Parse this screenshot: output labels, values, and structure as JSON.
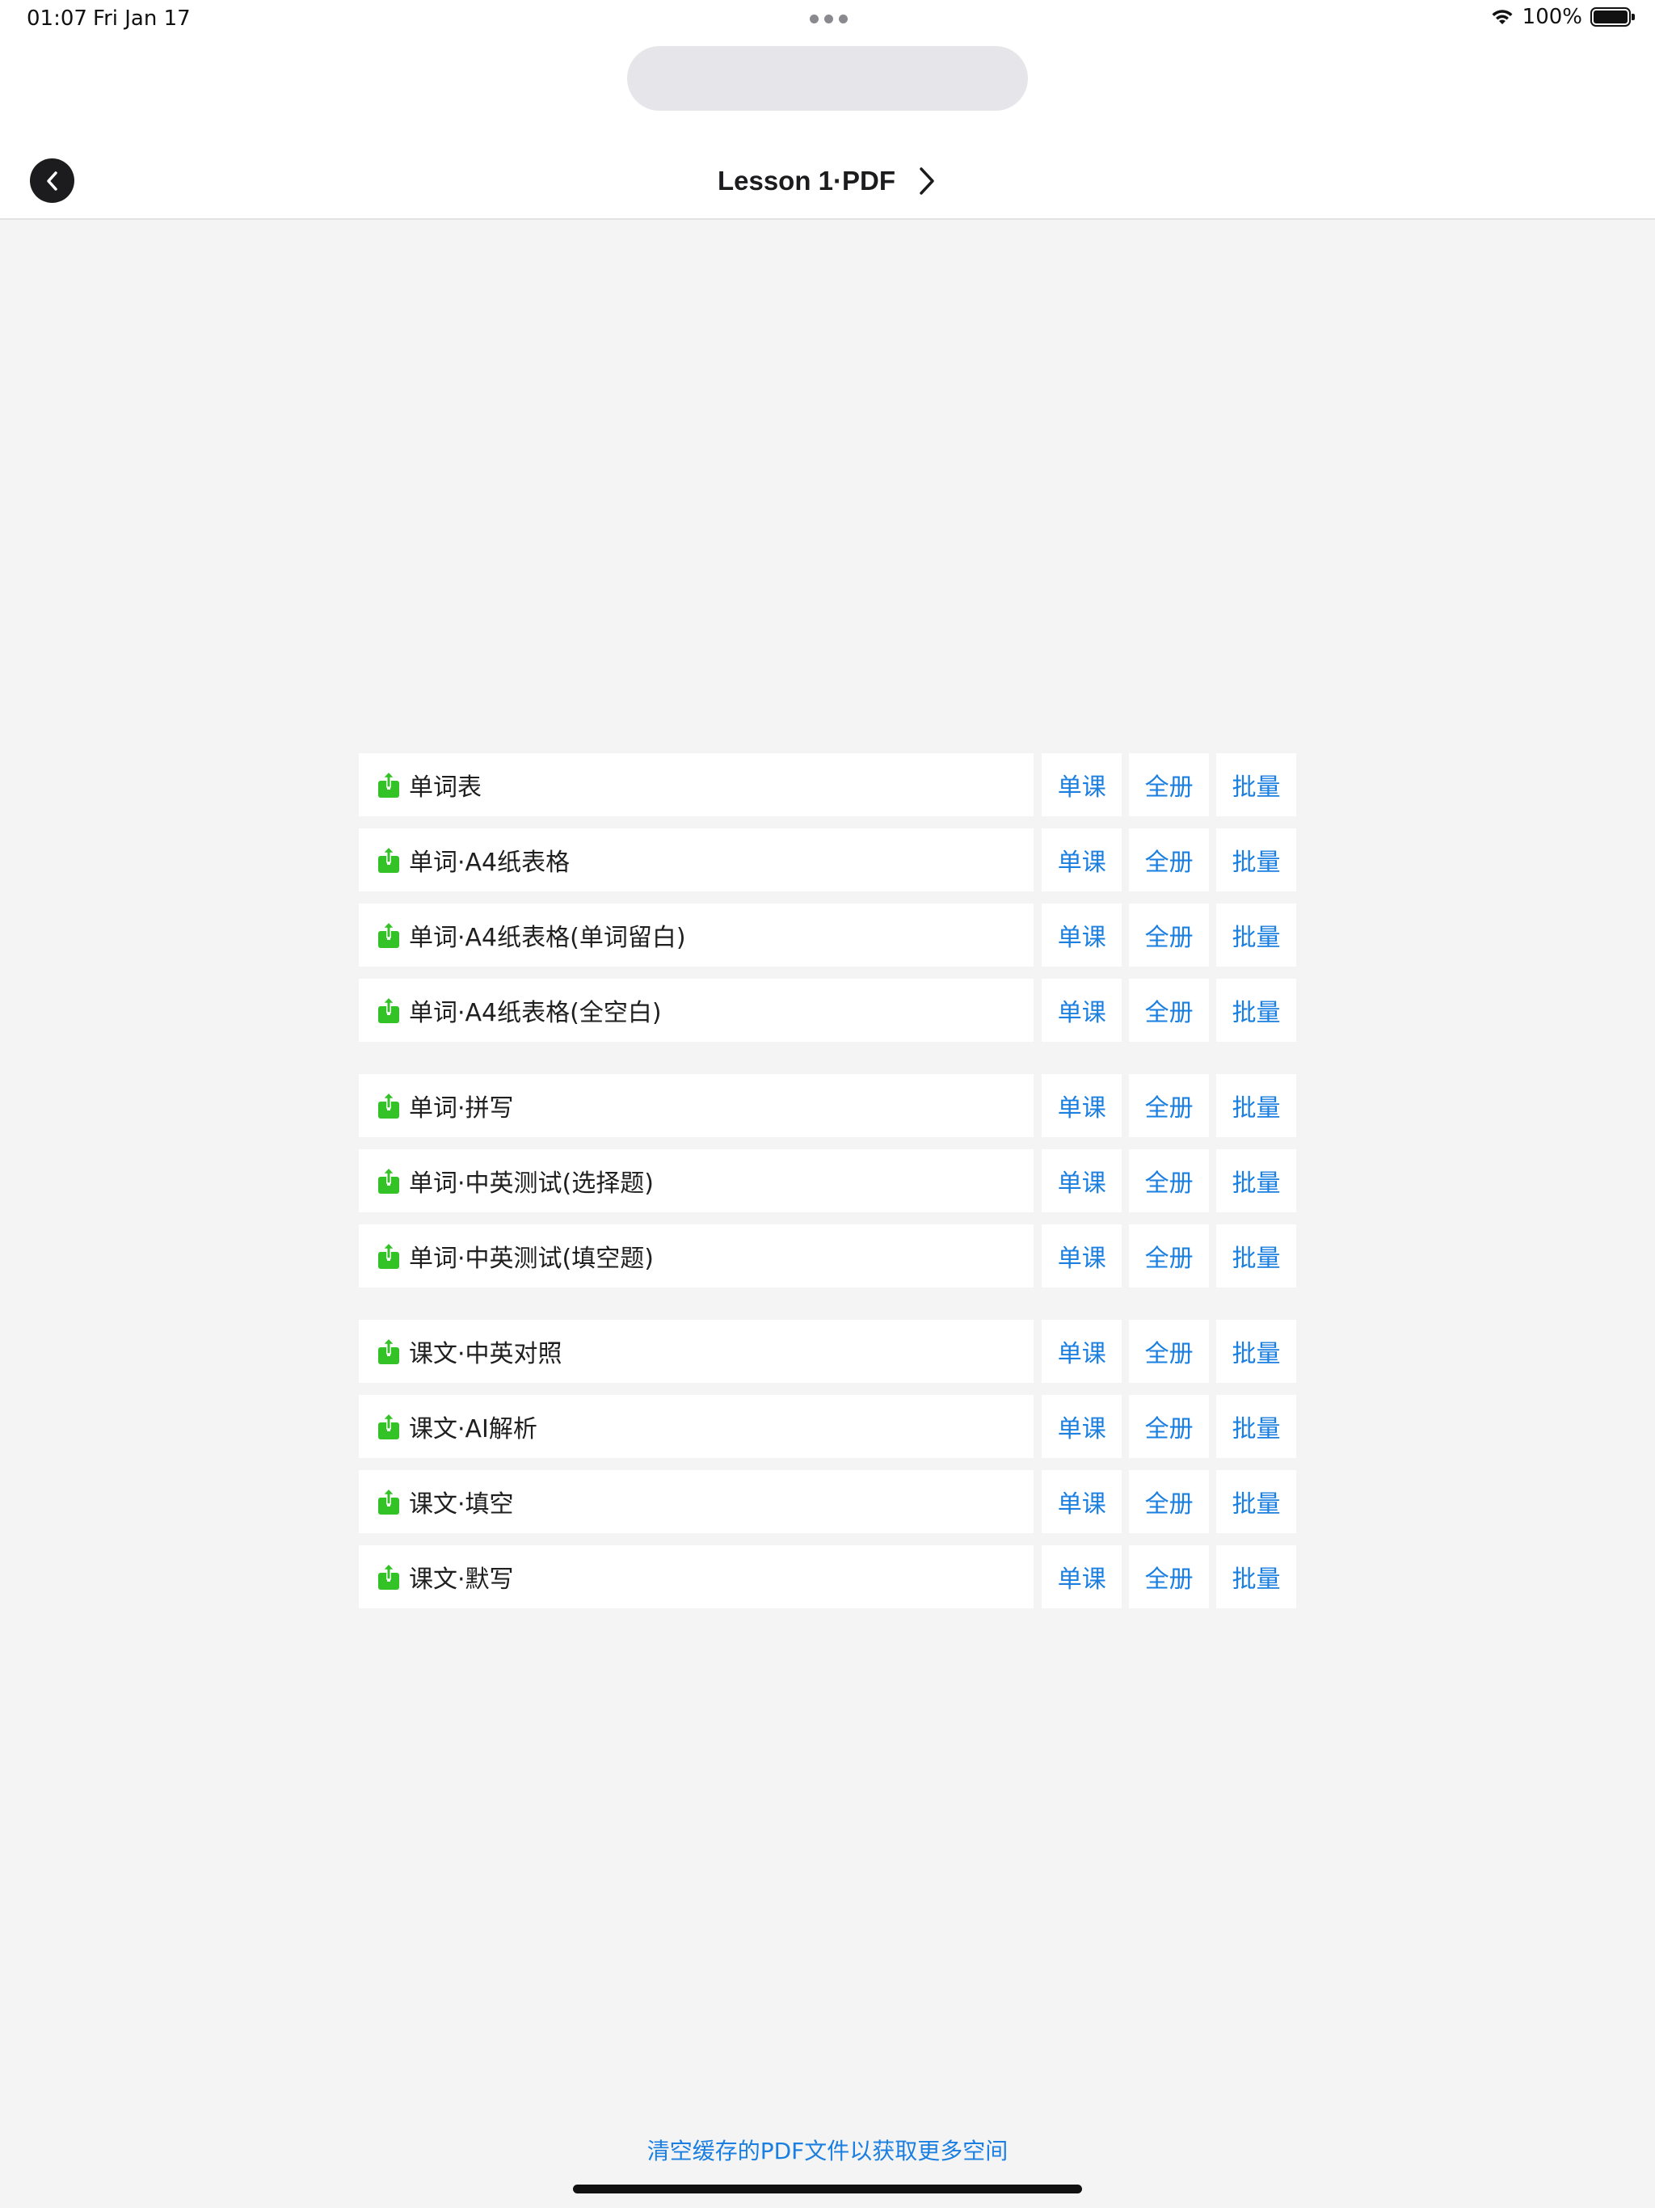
{
  "status_bar": {
    "time": "01:07",
    "date": "Fri Jan 17",
    "battery_percent": "100%",
    "icons": [
      "wifi-icon",
      "battery-icon"
    ]
  },
  "nav": {
    "back_icon": "chevron-left-icon",
    "title": "Lesson 1·PDF",
    "title_icon": "chevron-right-icon"
  },
  "row_icon": "share-upload-icon",
  "accent_color": "#1a7fe0",
  "icon_color": "#34c326",
  "buttons": {
    "single": "单课",
    "whole": "全册",
    "batch": "批量"
  },
  "items": [
    {
      "label": "单词表"
    },
    {
      "label": "单词·A4纸表格"
    },
    {
      "label": "单词·A4纸表格(单词留白)"
    },
    {
      "label": "单词·A4纸表格(全空白)"
    },
    {
      "label": "单词·拼写"
    },
    {
      "label": "单词·中英测试(选择题)"
    },
    {
      "label": "单词·中英测试(填空题)"
    },
    {
      "label": "课文·中英对照"
    },
    {
      "label": "课文·AI解析"
    },
    {
      "label": "课文·填空"
    },
    {
      "label": "课文·默写"
    }
  ],
  "footer": {
    "clear_cache": "清空缓存的PDF文件以获取更多空间"
  }
}
